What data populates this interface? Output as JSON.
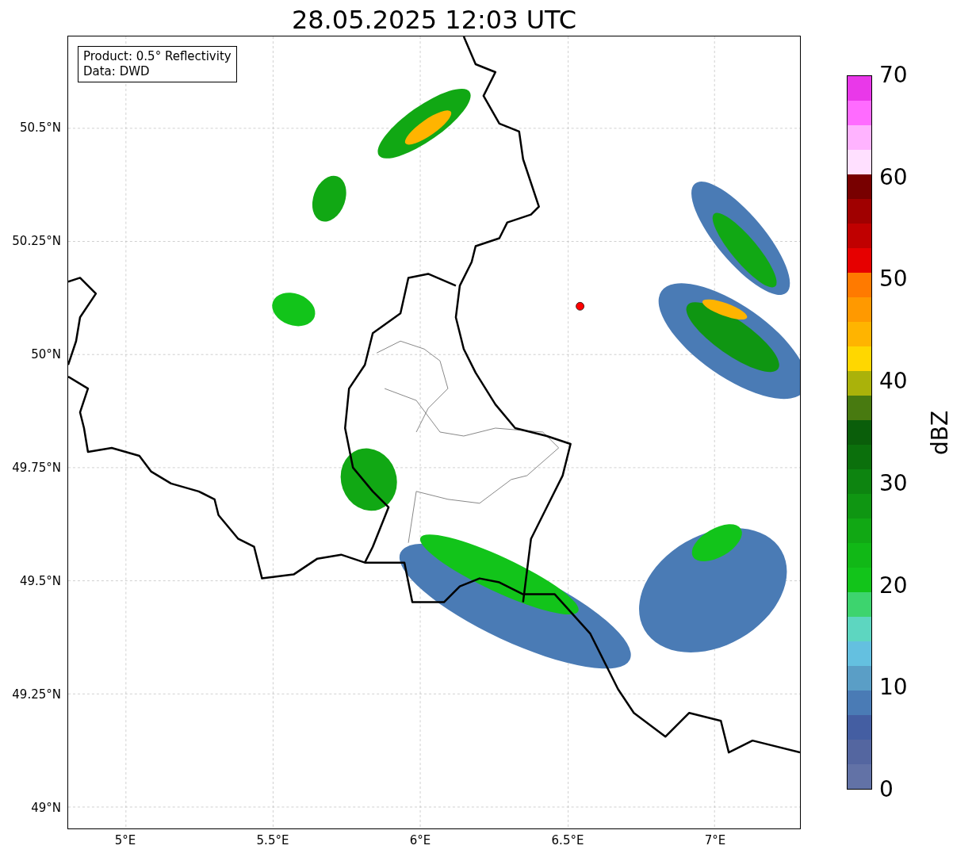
{
  "title": "28.05.2025 12:03 UTC",
  "info_box": [
    "Product: 0.5° Reflectivity",
    "Data: DWD"
  ],
  "y_axis": {
    "ticks": [
      "50.5°N",
      "50.25°N",
      "50°N",
      "49.75°N",
      "49.5°N",
      "49.25°N",
      "49°N"
    ]
  },
  "x_axis": {
    "ticks": [
      "5°E",
      "5.5°E",
      "6°E",
      "6.5°E",
      "7°E"
    ]
  },
  "colorbar": {
    "label": "dBZ",
    "ticks": [
      "70",
      "60",
      "50",
      "40",
      "30",
      "20",
      "10",
      "0"
    ],
    "segments": [
      {
        "color": "#e938e9"
      },
      {
        "color": "#ff6bff"
      },
      {
        "color": "#ffb3ff"
      },
      {
        "color": "#ffe0ff"
      },
      {
        "color": "#780000"
      },
      {
        "color": "#a00000"
      },
      {
        "color": "#c00000"
      },
      {
        "color": "#e60000"
      },
      {
        "color": "#ff7a00"
      },
      {
        "color": "#ff9900"
      },
      {
        "color": "#ffb400"
      },
      {
        "color": "#ffd700"
      },
      {
        "color": "#aab20a"
      },
      {
        "color": "#487a10"
      },
      {
        "color": "#0a5e0a"
      },
      {
        "color": "#0b700c"
      },
      {
        "color": "#0d8410"
      },
      {
        "color": "#0f9612"
      },
      {
        "color": "#11a814"
      },
      {
        "color": "#11b816"
      },
      {
        "color": "#12c41a"
      },
      {
        "color": "#3dd46e"
      },
      {
        "color": "#5dd6c0"
      },
      {
        "color": "#64c0e0"
      },
      {
        "color": "#5a9ec6"
      },
      {
        "color": "#4a7bb5"
      },
      {
        "color": "#445ea2"
      },
      {
        "color": "#5466a0"
      },
      {
        "color": "#6272a6"
      }
    ]
  }
}
